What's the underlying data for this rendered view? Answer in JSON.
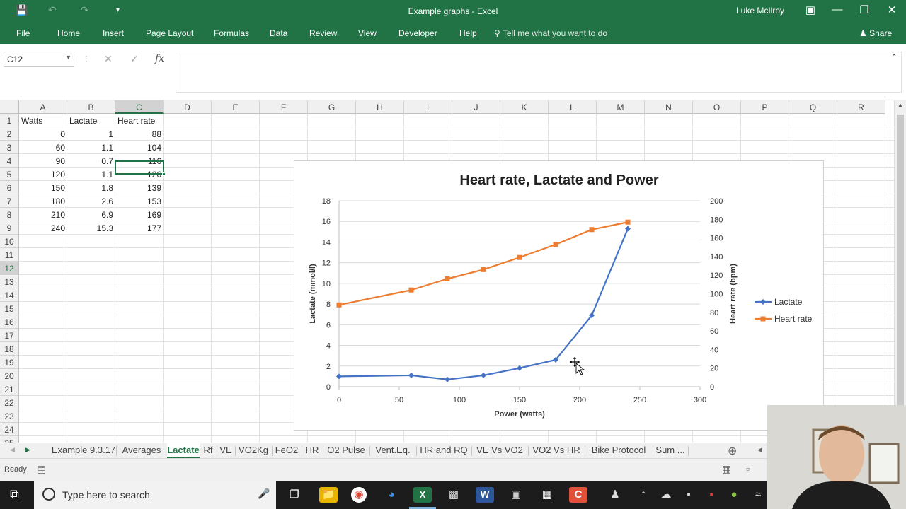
{
  "app": {
    "title": "Example graphs  -  Excel",
    "user": "Luke McIlroy"
  },
  "ribbon": {
    "tabs": [
      "File",
      "Home",
      "Insert",
      "Page Layout",
      "Formulas",
      "Data",
      "Review",
      "View",
      "Developer",
      "Help"
    ],
    "tell_me": "Tell me what you want to do",
    "share": "Share"
  },
  "formula_bar": {
    "name_box": "C12",
    "fx": "fx",
    "value": ""
  },
  "columns": [
    "A",
    "B",
    "C",
    "D",
    "E",
    "F",
    "G",
    "H",
    "I",
    "J",
    "K",
    "L",
    "M",
    "N",
    "O",
    "P",
    "Q",
    "R"
  ],
  "rows": [
    "1",
    "2",
    "3",
    "4",
    "5",
    "6",
    "7",
    "8",
    "9",
    "10",
    "11",
    "12",
    "13",
    "14",
    "15",
    "16",
    "17",
    "18",
    "19",
    "20",
    "21",
    "22",
    "23",
    "24",
    "25"
  ],
  "sheet": {
    "headers": [
      "Watts",
      "Lactate",
      "Heart rate"
    ],
    "data": [
      [
        "0",
        "1",
        "88"
      ],
      [
        "60",
        "1.1",
        "104"
      ],
      [
        "90",
        "0.7",
        "116"
      ],
      [
        "120",
        "1.1",
        "126"
      ],
      [
        "150",
        "1.8",
        "139"
      ],
      [
        "180",
        "2.6",
        "153"
      ],
      [
        "210",
        "6.9",
        "169"
      ],
      [
        "240",
        "15.3",
        "177"
      ]
    ],
    "selected_cell": "C12"
  },
  "chart_data": {
    "type": "line",
    "title": "Heart rate, Lactate and Power",
    "xlabel": "Power (watts)",
    "ylabel": "Lactate (mmol/l)",
    "y2label": "Heart rate (bpm)",
    "xlim": [
      0,
      300
    ],
    "ylim": [
      0,
      18
    ],
    "y2lim": [
      0,
      200
    ],
    "x_ticks": [
      "0",
      "50",
      "100",
      "150",
      "200",
      "250",
      "300"
    ],
    "y_ticks": [
      "0",
      "2",
      "4",
      "6",
      "8",
      "10",
      "12",
      "14",
      "16",
      "18"
    ],
    "y2_ticks": [
      "0",
      "20",
      "40",
      "60",
      "80",
      "100",
      "120",
      "140",
      "160",
      "180",
      "200"
    ],
    "grid": true,
    "legend": "right",
    "x": [
      0,
      60,
      90,
      120,
      150,
      180,
      210,
      240
    ],
    "series": [
      {
        "name": "Lactate",
        "axis": "left",
        "color": "#4472c4",
        "marker": "diamond",
        "values": [
          1,
          1.1,
          0.7,
          1.1,
          1.8,
          2.6,
          6.9,
          15.3
        ]
      },
      {
        "name": "Heart rate",
        "axis": "right",
        "color": "#ed7d31",
        "marker": "square",
        "values": [
          88,
          104,
          116,
          126,
          139,
          153,
          169,
          177
        ]
      }
    ]
  },
  "sheet_tabs": {
    "tabs": [
      "Example 9.3.17",
      "Averages",
      "Lactate",
      "Rf",
      "VE",
      "VO2Kg",
      "FeO2",
      "HR",
      "O2 Pulse",
      "Vent.Eq.",
      "HR and RQ",
      "VE Vs VO2",
      "VO2 Vs HR",
      "Bike Protocol",
      "Sum ..."
    ],
    "active": "Lactate"
  },
  "status": {
    "ready": "Ready"
  },
  "taskbar": {
    "search_placeholder": "Type here to search"
  }
}
